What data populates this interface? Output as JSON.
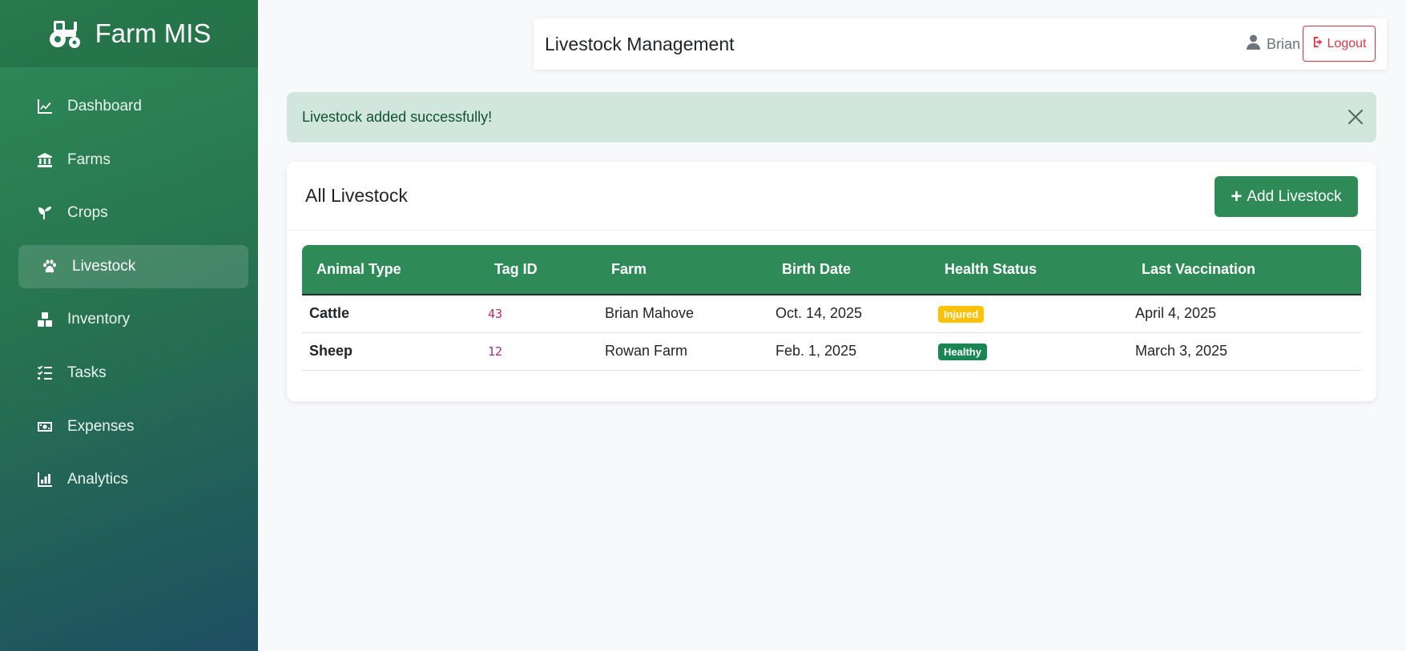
{
  "brand": {
    "title": "Farm MIS",
    "icon": "tractor-icon"
  },
  "sidebar": {
    "items": [
      {
        "label": "Dashboard",
        "icon": "chart-line-icon",
        "active": false
      },
      {
        "label": "Farms",
        "icon": "building-columns-icon",
        "active": false
      },
      {
        "label": "Crops",
        "icon": "seedling-icon",
        "active": false
      },
      {
        "label": "Livestock",
        "icon": "paw-icon",
        "active": true
      },
      {
        "label": "Inventory",
        "icon": "boxes-icon",
        "active": false
      },
      {
        "label": "Tasks",
        "icon": "list-check-icon",
        "active": false
      },
      {
        "label": "Expenses",
        "icon": "money-bill-icon",
        "active": false
      },
      {
        "label": "Analytics",
        "icon": "chart-bar-icon",
        "active": false
      }
    ]
  },
  "header": {
    "title": "Livestock Management",
    "user_name": "Brian",
    "logout_label": "Logout"
  },
  "alert": {
    "message": "Livestock added successfully!",
    "type": "success"
  },
  "card": {
    "title": "All Livestock",
    "add_button_label": "Add Livestock",
    "table": {
      "columns": [
        "Animal Type",
        "Tag ID",
        "Farm",
        "Birth Date",
        "Health Status",
        "Last Vaccination"
      ],
      "rows": [
        {
          "animal_type": "Cattle",
          "tag_id": "43",
          "farm": "Brian Mahove",
          "birth_date": "Oct. 14, 2025",
          "health_status": "Injured",
          "last_vaccination": "April 4, 2025"
        },
        {
          "animal_type": "Sheep",
          "tag_id": "12",
          "farm": "Rowan Farm",
          "birth_date": "Feb. 1, 2025",
          "health_status": "Healthy",
          "last_vaccination": "March 3, 2025"
        }
      ]
    }
  },
  "colors": {
    "primary_green": "#2e8b57",
    "injured_badge": "#ffc107",
    "healthy_badge": "#198754",
    "danger": "#dc3545",
    "alert_bg": "#d1e7dd"
  }
}
